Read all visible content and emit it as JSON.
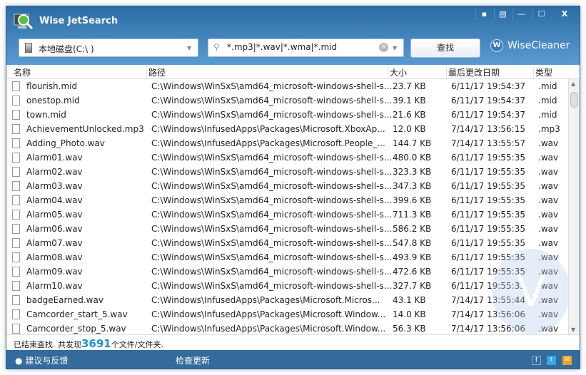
{
  "app": {
    "title": "Wise JetSearch",
    "brand": "WiseCleaner"
  },
  "toolbar": {
    "drive": "本地磁盘(C:\\ )",
    "query": "*.mp3|*.wav|*.wma|*.mid",
    "search_label": "查找"
  },
  "columns": [
    "名称",
    "路径",
    "大小",
    "最后更改日期",
    "类型"
  ],
  "rows": [
    [
      "flourish.mid",
      "C:\\Windows\\WinSxS\\amd64_microsoft-windows-shell-s...",
      "23.7 KB",
      "6/11/17 19:54:37",
      ".mid"
    ],
    [
      "onestop.mid",
      "C:\\Windows\\WinSxS\\amd64_microsoft-windows-shell-s...",
      "39.1 KB",
      "6/11/17 19:54:37",
      ".mid"
    ],
    [
      "town.mid",
      "C:\\Windows\\WinSxS\\amd64_microsoft-windows-shell-s...",
      "21.6 KB",
      "6/11/17 19:54:37",
      ".mid"
    ],
    [
      "AchievementUnlocked.mp3",
      "C:\\Windows\\InfusedApps\\Packages\\Microsoft.XboxAp...",
      "12.0 KB",
      "7/14/17 13:56:15",
      ".mp3"
    ],
    [
      "Adding_Photo.wav",
      "C:\\Windows\\InfusedApps\\Packages\\Microsoft.People_...",
      "144.7 KB",
      "7/14/17 13:55:57",
      ".wav"
    ],
    [
      "Alarm01.wav",
      "C:\\Windows\\WinSxS\\amd64_microsoft-windows-shell-s...",
      "480.0 KB",
      "6/11/17 19:55:35",
      ".wav"
    ],
    [
      "Alarm02.wav",
      "C:\\Windows\\WinSxS\\amd64_microsoft-windows-shell-s...",
      "323.3 KB",
      "6/11/17 19:55:35",
      ".wav"
    ],
    [
      "Alarm03.wav",
      "C:\\Windows\\WinSxS\\amd64_microsoft-windows-shell-s...",
      "347.3 KB",
      "6/11/17 19:55:35",
      ".wav"
    ],
    [
      "Alarm04.wav",
      "C:\\Windows\\WinSxS\\amd64_microsoft-windows-shell-s...",
      "399.6 KB",
      "6/11/17 19:55:35",
      ".wav"
    ],
    [
      "Alarm05.wav",
      "C:\\Windows\\WinSxS\\amd64_microsoft-windows-shell-s...",
      "711.3 KB",
      "6/11/17 19:55:35",
      ".wav"
    ],
    [
      "Alarm06.wav",
      "C:\\Windows\\WinSxS\\amd64_microsoft-windows-shell-s...",
      "586.2 KB",
      "6/11/17 19:55:35",
      ".wav"
    ],
    [
      "Alarm07.wav",
      "C:\\Windows\\WinSxS\\amd64_microsoft-windows-shell-s...",
      "547.8 KB",
      "6/11/17 19:55:35",
      ".wav"
    ],
    [
      "Alarm08.wav",
      "C:\\Windows\\WinSxS\\amd64_microsoft-windows-shell-s...",
      "493.9 KB",
      "6/11/17 19:55:35",
      ".wav"
    ],
    [
      "Alarm09.wav",
      "C:\\Windows\\WinSxS\\amd64_microsoft-windows-shell-s...",
      "472.6 KB",
      "6/11/17 19:55:35",
      ".wav"
    ],
    [
      "Alarm10.wav",
      "C:\\Windows\\WinSxS\\amd64_microsoft-windows-shell-s...",
      "327.7 KB",
      "6/11/17 19:55:35",
      ".wav"
    ],
    [
      "badgeEarned.wav",
      "C:\\Windows\\InfusedApps\\Packages\\Microsoft.Micros...",
      "43.1 KB",
      "7/14/17 13:55:44",
      ".wav"
    ],
    [
      "Camcorder_start_5.wav",
      "C:\\Windows\\InfusedApps\\Packages\\Microsoft.Window...",
      "14.0 KB",
      "7/14/17 13:56:06",
      ".wav"
    ],
    [
      "Camcorder_stop_5.wav",
      "C:\\Windows\\InfusedApps\\Packages\\Microsoft.Window...",
      "56.3 KB",
      "7/14/17 13:56:06",
      ".wav"
    ]
  ],
  "status": {
    "prefix": "已结束查找. 共发现",
    "count": "3691",
    "suffix": "个文件/文件夹."
  },
  "footer": {
    "feedback": "建议与反馈",
    "update": "检查更新"
  }
}
